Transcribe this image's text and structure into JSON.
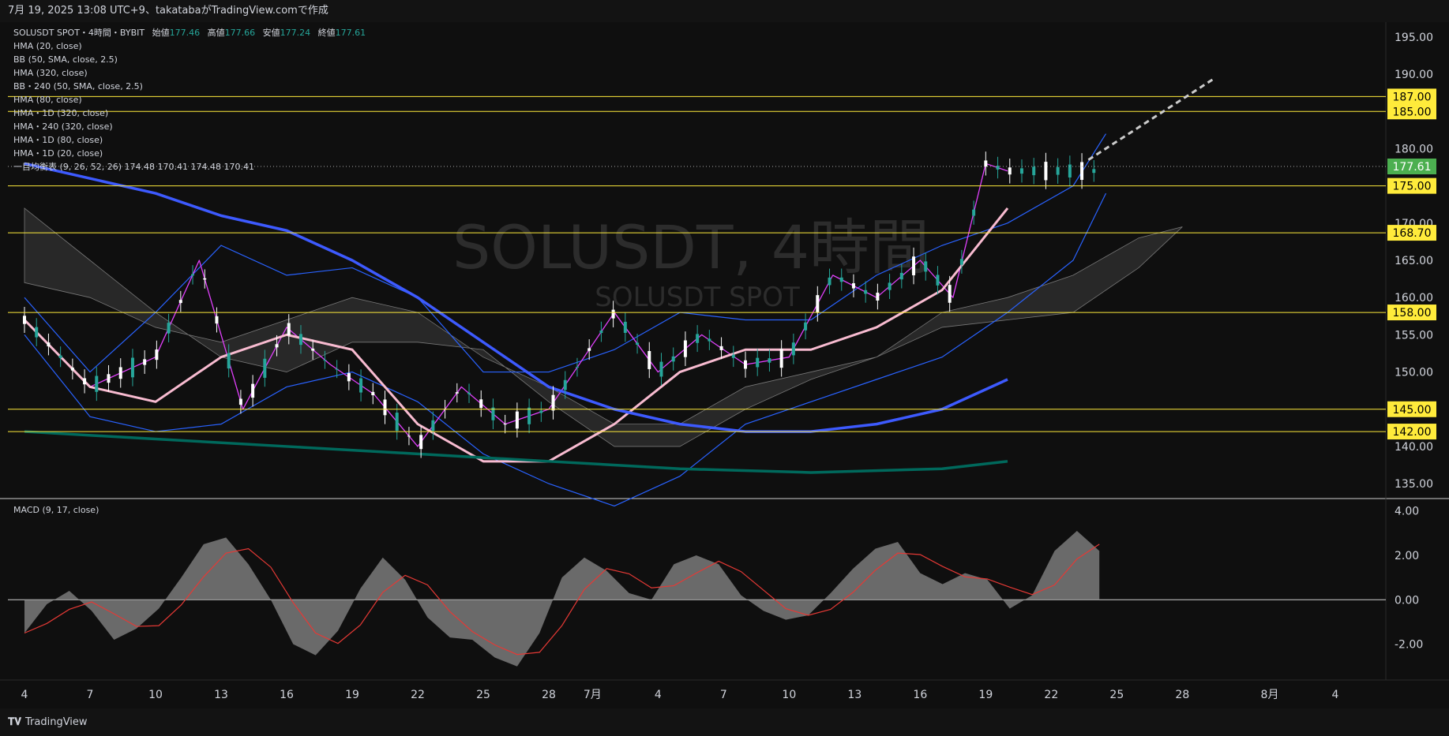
{
  "header": {
    "caption": "7月 19, 2025 13:08 UTC+9、takatabaがTradingView.comで作成"
  },
  "legend": {
    "symbol_line": "SOLUSDT SPOT・4時間・BYBIT",
    "open_label": "始値",
    "open": "177.46",
    "high_label": "高値",
    "high": "177.66",
    "low_label": "安値",
    "low": "177.24",
    "close_label": "終値",
    "close": "177.61",
    "indicators": [
      "HMA (20, close)",
      "BB (50, SMA, close, 2.5)",
      "HMA (320, close)",
      "BB・240 (50, SMA, close, 2.5)",
      "HMA (80, close)",
      "HMA・1D (320, close)",
      "HMA・240 (320, close)",
      "HMA・1D (80, close)",
      "HMA・1D (20, close)",
      "一目均衡表 (9, 26, 52, 26)  174.48  170.41  174.48  170.41"
    ]
  },
  "watermark": {
    "main": "SOLUSDT, 4時間",
    "sub": "SOLUSDT SPOT"
  },
  "macd_label": "MACD (9, 17, close)",
  "footer": {
    "brand": "TradingView"
  },
  "colors": {
    "up": "#26a69a",
    "down": "#ffffff",
    "bb": "#2962ff",
    "hma20": "#e040fb",
    "hma80": "#f8bbd0",
    "hma320": "#3d5afe",
    "hma320_1d": "#00695c",
    "level": "#ffeb3b",
    "current": "#4caf50"
  },
  "chart_data": {
    "type": "line",
    "title": "SOLUSDT, 4時間",
    "ylim": [
      133,
      197
    ],
    "y_ticks": [
      "195.00",
      "190.00",
      "185.00",
      "180.00",
      "175.00",
      "170.00",
      "165.00",
      "160.00",
      "155.00",
      "150.00",
      "145.00",
      "140.00",
      "135.00"
    ],
    "x_ticks": [
      "4",
      "7",
      "10",
      "13",
      "16",
      "19",
      "22",
      "25",
      "28",
      "7月",
      "4",
      "7",
      "10",
      "13",
      "16",
      "19",
      "22",
      "25",
      "28",
      "8月",
      "4"
    ],
    "horizontal_levels": [
      "187.00",
      "185.00",
      "175.00",
      "168.70",
      "158.00",
      "145.00",
      "142.00"
    ],
    "current_price": "177.61",
    "series": [
      {
        "name": "HMA (20, close)",
        "x": [
          4,
          7,
          10,
          12,
          14,
          16,
          18,
          20,
          22,
          24,
          26,
          28,
          1,
          3,
          5,
          7,
          9,
          11,
          13,
          15,
          16.5,
          18,
          19
        ],
        "y": [
          157,
          148,
          152,
          165,
          145,
          156,
          151,
          147,
          140,
          148,
          143,
          145,
          158,
          150,
          155,
          151,
          152,
          163,
          160,
          165,
          160,
          178,
          177
        ]
      },
      {
        "name": "HMA (80, close)",
        "x": [
          4,
          7,
          10,
          13,
          16,
          19,
          22,
          25,
          28,
          1,
          4,
          7,
          10,
          13,
          16,
          19
        ],
        "y": [
          157,
          148,
          146,
          152,
          155,
          153,
          143,
          138,
          138,
          143,
          150,
          153,
          153,
          156,
          161,
          172
        ]
      },
      {
        "name": "HMA (320, close)",
        "x": [
          4,
          7,
          10,
          13,
          16,
          19,
          22,
          25,
          28,
          1,
          4,
          7,
          10,
          13,
          16,
          19
        ],
        "y": [
          178,
          176,
          174,
          171,
          169,
          165,
          160,
          154,
          148,
          145,
          143,
          142,
          142,
          143,
          145,
          149
        ]
      },
      {
        "name": "HMA・1D (320, close)",
        "x": [
          4,
          10,
          16,
          22,
          28,
          4,
          10,
          16,
          19
        ],
        "y": [
          142,
          141,
          140,
          139,
          138,
          137,
          136.5,
          137,
          138
        ]
      }
    ],
    "macd": {
      "label": "MACD (9, 17, close)",
      "ylim": [
        -3.4,
        4.2
      ],
      "y_ticks": [
        "4.00",
        "2.00",
        "0.00",
        "-2.00"
      ],
      "values": [
        -1.5,
        -0.2,
        0.4,
        -0.5,
        -1.8,
        -1.3,
        -0.4,
        1.0,
        2.5,
        2.8,
        1.6,
        0.0,
        -2.0,
        -2.5,
        -1.4,
        0.5,
        1.9,
        0.9,
        -0.8,
        -1.7,
        -1.8,
        -2.6,
        -3.0,
        -1.5,
        1.0,
        1.9,
        1.3,
        0.3,
        0.0,
        1.6,
        2.0,
        1.6,
        0.2,
        -0.5,
        -0.9,
        -0.7,
        0.3,
        1.4,
        2.3,
        2.6,
        1.2,
        0.7,
        1.2,
        0.9,
        -0.4,
        0.2,
        2.2,
        3.1,
        2.2
      ]
    }
  }
}
